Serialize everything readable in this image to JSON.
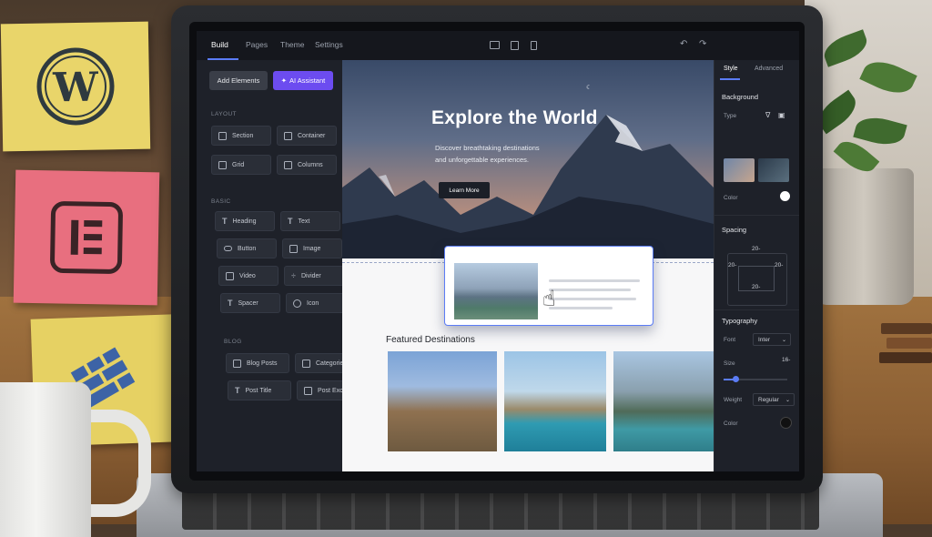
{
  "topbar": {
    "tabs": [
      "Build",
      "Pages",
      "Theme",
      "Settings"
    ],
    "active_tab": "Build",
    "devices": [
      "desktop-icon",
      "tablet-icon",
      "mobile-icon"
    ]
  },
  "left_panel": {
    "add_elements_label": "Add Elements",
    "ai_assistant_label": "AI Assistant",
    "layout_label": "LAYOUT",
    "layout_items": [
      "Section",
      "Container",
      "Grid",
      "Columns"
    ],
    "basic_label": "BASIC",
    "basic_items": [
      "Heading",
      "Text",
      "Button",
      "Image",
      "Video",
      "Divider",
      "Spacer",
      "Icon"
    ],
    "blog_label": "BLOG",
    "blog_items": [
      "Blog Posts",
      "Categories",
      "Post Title",
      "Post Excerpt"
    ]
  },
  "canvas": {
    "hero_title": "Explore the World",
    "hero_subtitle_line1": "Discover breathtaking destinations",
    "hero_subtitle_line2": "and unforgettable experiences.",
    "hero_button": "Learn More",
    "featured_heading": "Featured Destinations"
  },
  "right_panel": {
    "tabs": [
      "Style",
      "Advanced"
    ],
    "active_tab": "Style",
    "background_heading": "Background",
    "type_label": "Type",
    "color_label": "Color",
    "background_color": "#ffffff",
    "spacing_heading": "Spacing",
    "spacing_top": "20",
    "spacing_right": "20",
    "spacing_bottom": "20",
    "spacing_left": "20",
    "typography_heading": "Typography",
    "font_label": "Font",
    "font_value": "Inter",
    "size_label": "Size",
    "size_value": "16",
    "weight_label": "Weight",
    "weight_value": "Regular",
    "text_color_label": "Color",
    "text_color": "#111111"
  },
  "colors": {
    "accent": "#5b7cf6",
    "ai_button": "#6c4cf0",
    "panel_bg": "#1e2129",
    "note_yellow": "#e9d56a",
    "note_pink": "#e86f7f"
  },
  "sticky_notes": [
    "wordpress-logo",
    "elementor-logo",
    "blocks-logo"
  ]
}
